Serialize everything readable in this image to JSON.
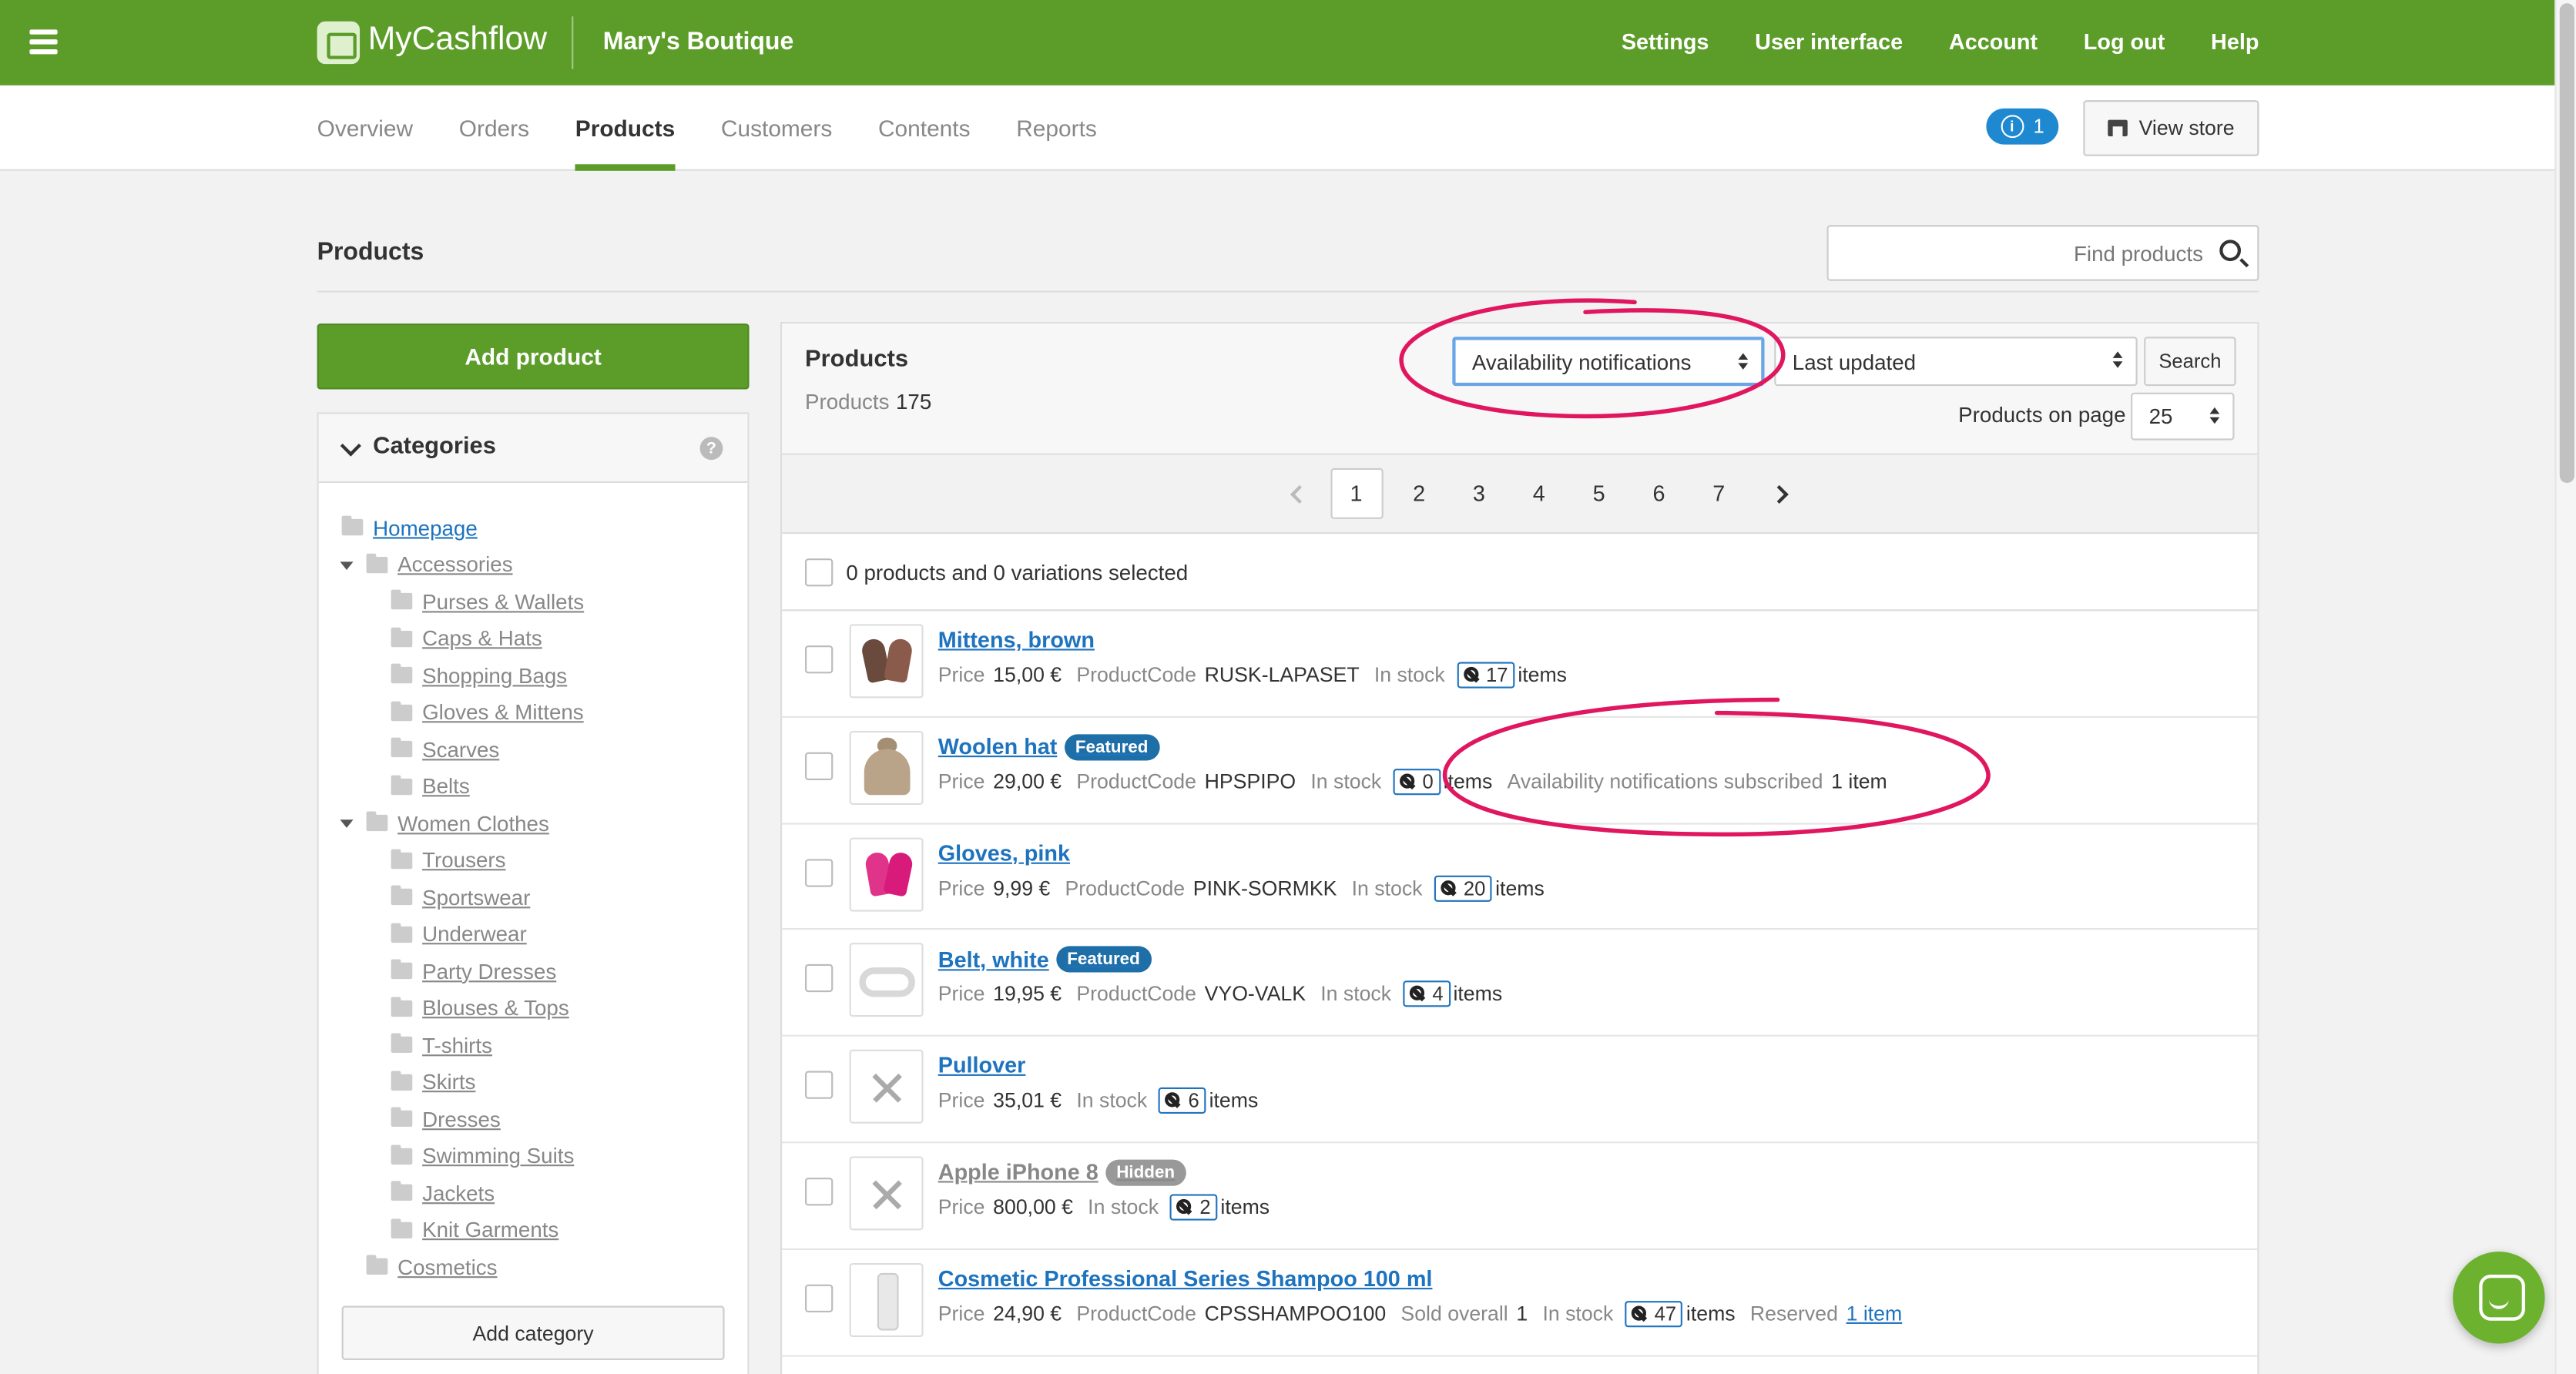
{
  "topbar": {
    "logo": "MyCashflow",
    "store_name": "Mary's Boutique",
    "links": [
      "Settings",
      "User interface",
      "Account",
      "Log out",
      "Help"
    ]
  },
  "nav": {
    "tabs": [
      "Overview",
      "Orders",
      "Products",
      "Customers",
      "Contents",
      "Reports"
    ],
    "active_tab": "Products",
    "notifications_count": "1",
    "view_store": "View store"
  },
  "page": {
    "title": "Products",
    "search_placeholder": "Find products"
  },
  "sidebar": {
    "add_product": "Add product",
    "categories_title": "Categories",
    "categories": [
      {
        "label": "Homepage",
        "level": 0
      },
      {
        "label": "Accessories",
        "level": 1,
        "expanded": true
      },
      {
        "label": "Purses & Wallets",
        "level": 2
      },
      {
        "label": "Caps & Hats",
        "level": 2
      },
      {
        "label": "Shopping Bags",
        "level": 2
      },
      {
        "label": "Gloves & Mittens",
        "level": 2
      },
      {
        "label": "Scarves",
        "level": 2
      },
      {
        "label": "Belts",
        "level": 2
      },
      {
        "label": "Women Clothes",
        "level": 1,
        "expanded": true
      },
      {
        "label": "Trousers",
        "level": 2
      },
      {
        "label": "Sportswear",
        "level": 2
      },
      {
        "label": "Underwear",
        "level": 2
      },
      {
        "label": "Party Dresses",
        "level": 2
      },
      {
        "label": "Blouses & Tops",
        "level": 2
      },
      {
        "label": "T-shirts",
        "level": 2
      },
      {
        "label": "Skirts",
        "level": 2
      },
      {
        "label": "Dresses",
        "level": 2
      },
      {
        "label": "Swimming Suits",
        "level": 2
      },
      {
        "label": "Jackets",
        "level": 2
      },
      {
        "label": "Knit Garments",
        "level": 2
      },
      {
        "label": "Cosmetics",
        "level": 1
      }
    ],
    "add_category": "Add category"
  },
  "main": {
    "title": "Products",
    "count_label": "Products",
    "count_value": "175",
    "filter_select": "Availability notifications",
    "sort_select": "Last updated",
    "search_button": "Search",
    "per_page_label": "Products on page",
    "per_page_value": "25",
    "pages": [
      "1",
      "2",
      "3",
      "4",
      "5",
      "6",
      "7"
    ],
    "current_page": "1",
    "selected_text": "0 products and 0 variations selected",
    "labels": {
      "price": "Price",
      "product_code": "ProductCode",
      "in_stock": "In stock",
      "items": "items",
      "sold_overall": "Sold overall",
      "reserved": "Reserved",
      "avail_subscribed": "Availability notifications subscribed"
    },
    "products": [
      {
        "name": "Mittens, brown",
        "price": "15,00 €",
        "code": "RUSK-LAPASET",
        "stock": "17"
      },
      {
        "name": "Woolen hat",
        "badge": "Featured",
        "price": "29,00 €",
        "code": "HPSPIPO",
        "stock": "0",
        "avail": "1 item"
      },
      {
        "name": "Gloves, pink",
        "price": "9,99 €",
        "code": "PINK-SORMKK",
        "stock": "20"
      },
      {
        "name": "Belt, white",
        "badge": "Featured",
        "price": "19,95 €",
        "code": "VYO-VALK",
        "stock": "4"
      },
      {
        "name": "Pullover",
        "price": "35,01 €",
        "stock": "6"
      },
      {
        "name": "Apple iPhone 8",
        "badge": "Hidden",
        "price": "800,00 €",
        "stock": "2"
      },
      {
        "name": "Cosmetic Professional Series Shampoo 100 ml",
        "price": "24,90 €",
        "code": "CPSSHAMPOO100",
        "sold": "1",
        "stock": "47",
        "reserved": "1 item"
      }
    ]
  },
  "colors": {
    "brand_green": "#5c9d2a",
    "link_blue": "#1e73be",
    "annotation_pink": "#e0175f"
  }
}
